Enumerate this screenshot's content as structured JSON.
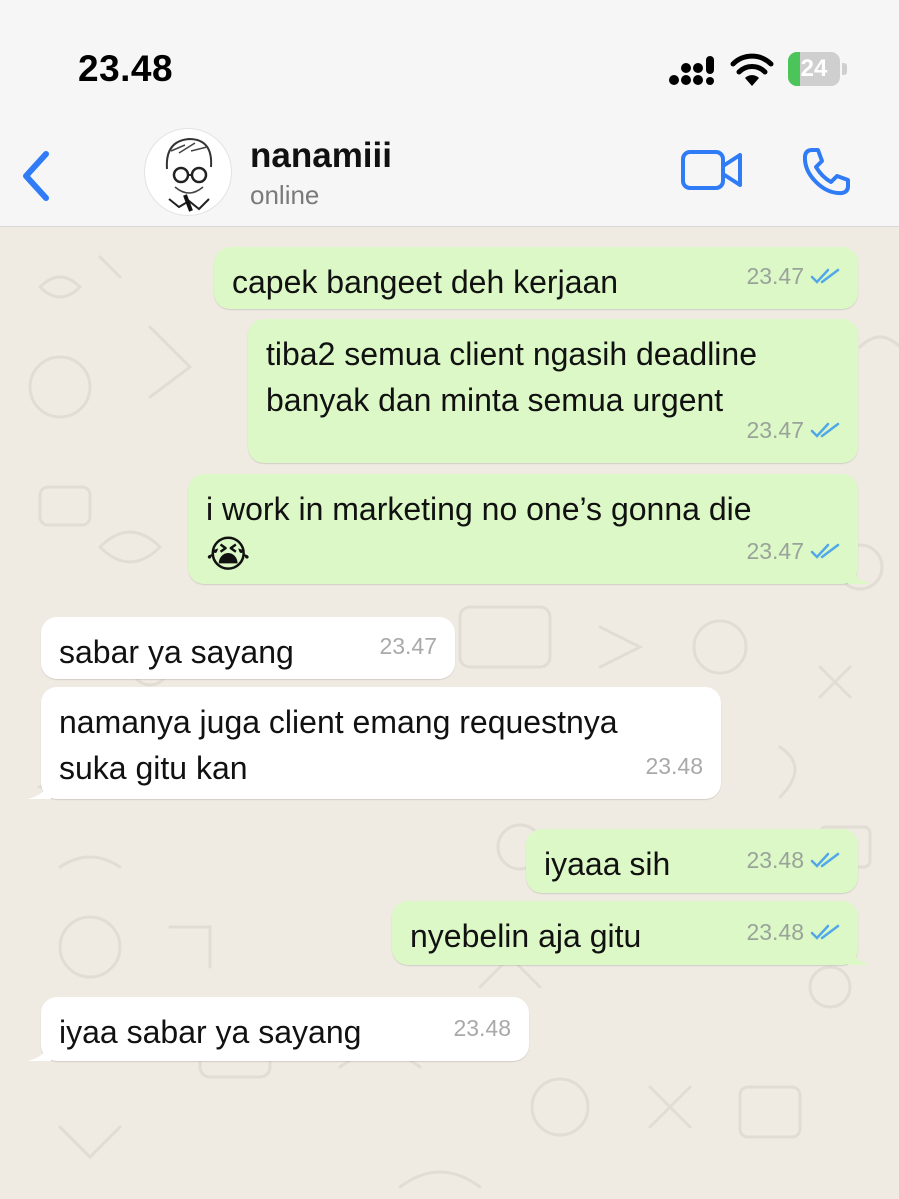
{
  "status_bar": {
    "time": "23.48",
    "battery": "24",
    "battery_level": 0.24
  },
  "header": {
    "back_icon": "chevron-left-icon",
    "contact_name": "nanamiii",
    "contact_status": "online",
    "video_icon": "video-camera-icon",
    "call_icon": "phone-icon"
  },
  "colors": {
    "accent": "#2f7cf6",
    "outgoing_bubble": "#dcf8c6",
    "incoming_bubble": "#ffffff",
    "read_ticks": "#4fa8e8",
    "background": "#efeae2"
  },
  "messages": [
    {
      "direction": "out",
      "text": "capek bangeet deh kerjaan",
      "time": "23.47",
      "status": "read"
    },
    {
      "direction": "out",
      "text": "tiba2 semua client ngasih deadline banyak dan minta semua urgent",
      "time": "23.47",
      "status": "read"
    },
    {
      "direction": "out",
      "text": "i work in marketing no one’s gonna die",
      "emoji": "😭",
      "time": "23.47",
      "status": "read"
    },
    {
      "direction": "in",
      "text": "sabar ya sayang",
      "time": "23.47"
    },
    {
      "direction": "in",
      "text": "namanya juga client emang requestnya suka gitu kan",
      "time": "23.48"
    },
    {
      "direction": "out",
      "text": "iyaaa sih",
      "time": "23.48",
      "status": "read"
    },
    {
      "direction": "out",
      "text": "nyebelin aja gitu",
      "time": "23.48",
      "status": "read"
    },
    {
      "direction": "in",
      "text": "iyaa sabar ya sayang",
      "time": "23.48"
    }
  ]
}
